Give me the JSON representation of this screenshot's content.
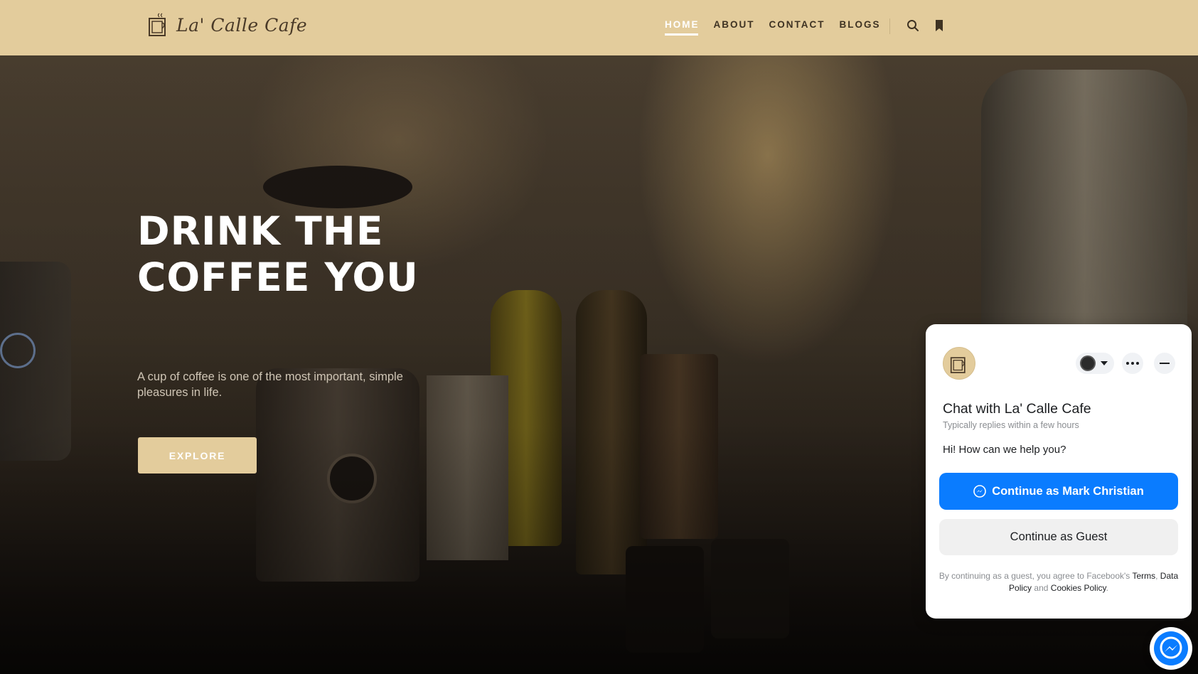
{
  "brand": {
    "name": "La' Calle Cafe",
    "color": "#e3cc9c"
  },
  "nav": {
    "items": [
      {
        "label": "HOME",
        "active": true
      },
      {
        "label": "ABOUT",
        "active": false
      },
      {
        "label": "CONTACT",
        "active": false
      },
      {
        "label": "BLOGS",
        "active": false
      }
    ],
    "icons": [
      "search-icon",
      "bookmark-icon"
    ]
  },
  "hero": {
    "title_line1": "DRINK THE",
    "title_line2": "COFFEE YOU",
    "subtitle": "A cup of coffee is one of the most important, simple pleasures in life.",
    "cta_label": "EXPLORE"
  },
  "chat": {
    "title": "Chat with La' Calle Cafe",
    "reply_time": "Typically replies within a few hours",
    "greeting": "Hi! How can we help you?",
    "continue_label": "Continue as Mark Christian",
    "guest_label": "Continue as Guest",
    "legal_prefix": "By continuing as a guest, you agree to Facebook's",
    "terms_link": "Terms",
    "data_policy_link": "Data Policy",
    "legal_and": "and",
    "cookies_link": "Cookies Policy",
    "accent_color": "#0a7cff",
    "icons": [
      "messenger-icon",
      "more-icon",
      "minimize-icon",
      "chevron-down-icon"
    ]
  }
}
